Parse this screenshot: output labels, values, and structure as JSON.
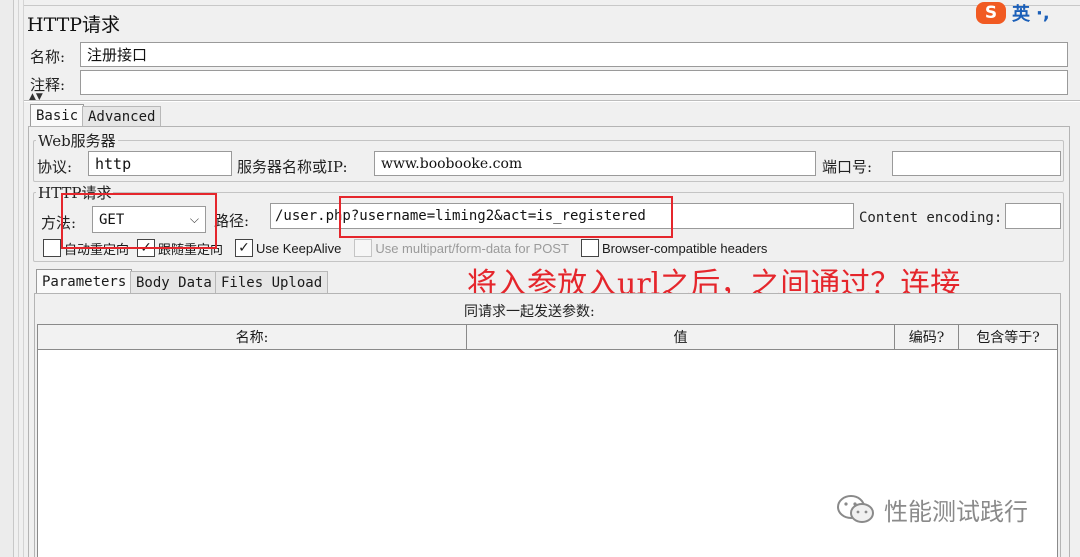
{
  "panel": {
    "title": "HTTP请求",
    "name_label": "名称:",
    "name_value": "注册接口",
    "comment_label": "注释:",
    "comment_value": ""
  },
  "tabs": {
    "basic": "Basic",
    "advanced": "Advanced"
  },
  "web_server": {
    "legend": "Web服务器",
    "protocol_label": "协议:",
    "protocol_value": "http",
    "server_label": "服务器名称或IP:",
    "server_value": "www.boobooke.com",
    "port_label": "端口号:",
    "port_value": ""
  },
  "http_request": {
    "legend": "HTTP请求",
    "method_label": "方法:",
    "method_value": "GET",
    "path_label": "路径:",
    "path_value": "/user.php?username=liming2&act=is_registered",
    "encoding_label": "Content encoding:",
    "encoding_value": ""
  },
  "options": {
    "auto_redirect": {
      "label": "自动重定向",
      "checked": false
    },
    "follow_redirect": {
      "label": "跟随重定向",
      "checked": true
    },
    "keepalive": {
      "label": "Use KeepAlive",
      "checked": true
    },
    "multipart": {
      "label": "Use multipart/form-data for POST",
      "checked": false,
      "disabled": true
    },
    "browser_headers": {
      "label": "Browser-compatible headers",
      "checked": false
    }
  },
  "subtabs": {
    "parameters": "Parameters",
    "body_data": "Body Data",
    "files_upload": "Files Upload"
  },
  "params_table": {
    "caption": "同请求一起发送参数:",
    "columns": [
      "名称:",
      "值",
      "编码?",
      "包含等于?"
    ],
    "rows": []
  },
  "annotation": "将入参放入url之后，之间通过？连接",
  "watermark": "性能测试践行",
  "ime": {
    "label": "英",
    "punct": "·,"
  },
  "colors": {
    "annotation_red": "#e5262c",
    "ime_orange": "#f15a22"
  }
}
